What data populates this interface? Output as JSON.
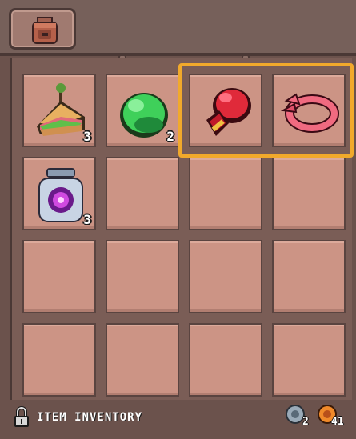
{
  "header": {
    "tab_icon": "backpack-icon"
  },
  "slots": [
    {
      "item": "sandwich",
      "icon": "sandwich-icon",
      "count": "3"
    },
    {
      "item": "green-cap",
      "icon": "green-cap-icon",
      "count": "2"
    },
    {
      "item": "boxing-glove",
      "icon": "boxing-glove-icon",
      "count": ""
    },
    {
      "item": "headband",
      "icon": "headband-icon",
      "count": ""
    },
    {
      "item": "magic-jar",
      "icon": "magic-jar-icon",
      "count": "3"
    }
  ],
  "footer": {
    "label": "ITEM INVENTORY",
    "currencies": [
      {
        "icon": "silver-coin-icon",
        "amount": "2"
      },
      {
        "icon": "orange-coin-icon",
        "amount": "41"
      }
    ]
  },
  "colors": {
    "highlight": "#f1a92b",
    "slot": "#cc9485",
    "frame": "#6b524c"
  }
}
